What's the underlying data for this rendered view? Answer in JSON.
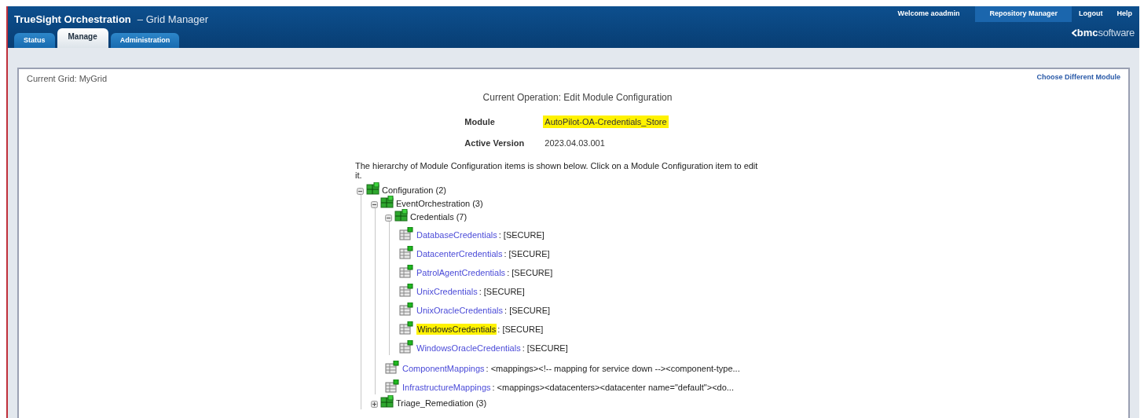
{
  "header": {
    "title": "TrueSight Orchestration",
    "subtitle": "– Grid Manager",
    "tabs": [
      {
        "label": "Status",
        "selected": false
      },
      {
        "label": "Manage",
        "selected": true
      },
      {
        "label": "Administration",
        "selected": false
      }
    ],
    "welcome": "Welcome aoadmin",
    "links": [
      {
        "label": "Repository Manager",
        "selected": true
      },
      {
        "label": "Logout",
        "selected": false
      },
      {
        "label": "Help",
        "selected": false
      }
    ],
    "logo": {
      "bold": "bmc",
      "light": "software"
    }
  },
  "panel": {
    "current_grid": "Current Grid: MyGrid",
    "choose_link": "Choose Different Module",
    "operation": "Current Operation: Edit Module Configuration",
    "fields": [
      {
        "label": "Module",
        "value": "AutoPilot-OA-Credentials_Store",
        "highlighted": true
      },
      {
        "label": "Active Version",
        "value": "2023.04.03.001",
        "highlighted": false
      }
    ],
    "intro": "The hierarchy of Module Configuration items is shown below. Click on a Module Configuration item to edit it.",
    "tree": [
      {
        "kind": "folder",
        "label": "Configuration (2)",
        "expanded": true,
        "children": [
          {
            "kind": "folder",
            "label": "EventOrchestration (3)",
            "expanded": true,
            "children": [
              {
                "kind": "folder",
                "label": "Credentials (7)",
                "expanded": true,
                "children": [
                  {
                    "kind": "item",
                    "key": "DatabaseCredentials",
                    "value": ": [SECURE]",
                    "highlighted": false
                  },
                  {
                    "kind": "item",
                    "key": "DatacenterCredentials",
                    "value": ": [SECURE]",
                    "highlighted": false
                  },
                  {
                    "kind": "item",
                    "key": "PatrolAgentCredentials",
                    "value": ": [SECURE]",
                    "highlighted": false
                  },
                  {
                    "kind": "item",
                    "key": "UnixCredentials",
                    "value": ": [SECURE]",
                    "highlighted": false
                  },
                  {
                    "kind": "item",
                    "key": "UnixOracleCredentials",
                    "value": ": [SECURE]",
                    "highlighted": false
                  },
                  {
                    "kind": "item",
                    "key": "WindowsCredentials",
                    "value": ": [SECURE]",
                    "highlighted": true
                  },
                  {
                    "kind": "item",
                    "key": "WindowsOracleCredentials",
                    "value": ": [SECURE]",
                    "highlighted": false
                  }
                ]
              },
              {
                "kind": "item",
                "key": "ComponentMappings",
                "value": ": <mappings><!-- mapping for service down --><component-type...",
                "highlighted": false
              },
              {
                "kind": "item",
                "key": "InfrastructureMappings",
                "value": ": <mappings><datacenters><datacenter name=\"default\"><do...",
                "highlighted": false
              }
            ]
          },
          {
            "kind": "folder",
            "label": "Triage_Remediation (3)",
            "expanded": false
          }
        ]
      }
    ]
  }
}
